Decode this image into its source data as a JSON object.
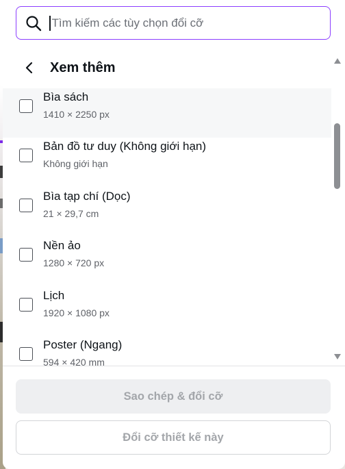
{
  "search": {
    "placeholder": "Tìm kiếm các tùy chọn đổi cỡ"
  },
  "header": {
    "title": "Xem thêm"
  },
  "items": [
    {
      "name": "Bìa sách",
      "dim": "1410 × 2250 px",
      "checked": false
    },
    {
      "name": "Bản đồ tư duy (Không giới hạn)",
      "dim": "Không giới hạn",
      "checked": false
    },
    {
      "name": "Bìa tạp chí (Dọc)",
      "dim": "21 × 29,7 cm",
      "checked": false
    },
    {
      "name": "Nền ảo",
      "dim": "1280 × 720 px",
      "checked": false
    },
    {
      "name": "Lịch",
      "dim": "1920 × 1080 px",
      "checked": false
    },
    {
      "name": "Poster (Ngang)",
      "dim": "594 × 420 mm",
      "checked": false
    }
  ],
  "buttons": {
    "copy_resize": "Sao chép & đổi cỡ",
    "resize_this": "Đổi cỡ thiết kế này"
  },
  "colors": {
    "accent": "#8b3dff",
    "text": "#0e1318",
    "muted": "#5e6167",
    "disabled_text": "#a3a6aa"
  },
  "icons": {
    "search": "search-icon",
    "back": "chevron-left-icon",
    "scroll_up": "triangle-up-icon",
    "scroll_down": "triangle-down-icon"
  }
}
